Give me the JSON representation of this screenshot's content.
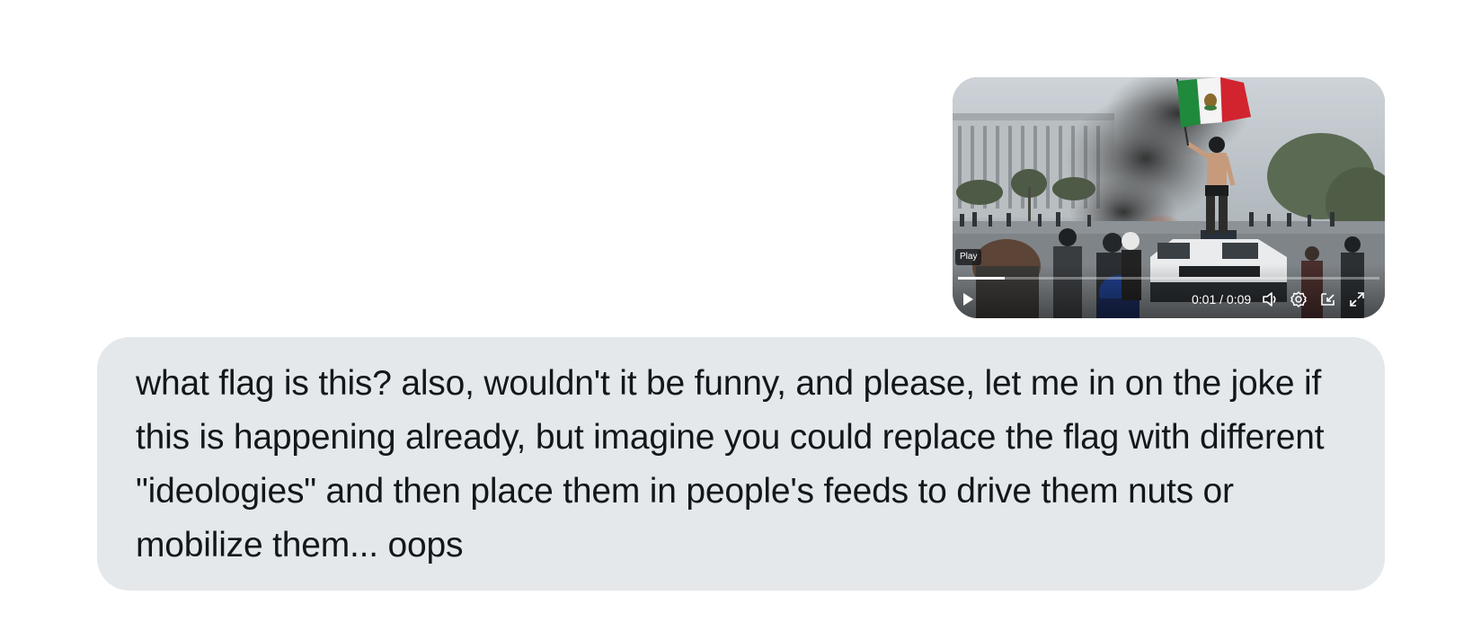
{
  "video": {
    "tooltip": "Play",
    "time": {
      "current": "0:01",
      "separator": " / ",
      "total": "0:09"
    },
    "progress": 0.11,
    "icons": {
      "play": "play-icon",
      "volume": "volume-icon",
      "settings": "settings-gear-icon",
      "pip": "picture-in-picture-icon",
      "fullscreen": "fullscreen-icon"
    }
  },
  "message": {
    "text": "what flag is this? also, wouldn't it be funny, and please, let me in on the joke if this is happening already, but imagine you could replace the flag with different \"ideologies\" and then place them in people's feeds to drive them nuts or mobilize them... oops"
  },
  "colors": {
    "bubble_background": "#e5e8eb",
    "text": "#14171a",
    "flag_green": "#1f8a3c",
    "flag_white": "#f4f4f4",
    "flag_red": "#d1242f"
  }
}
